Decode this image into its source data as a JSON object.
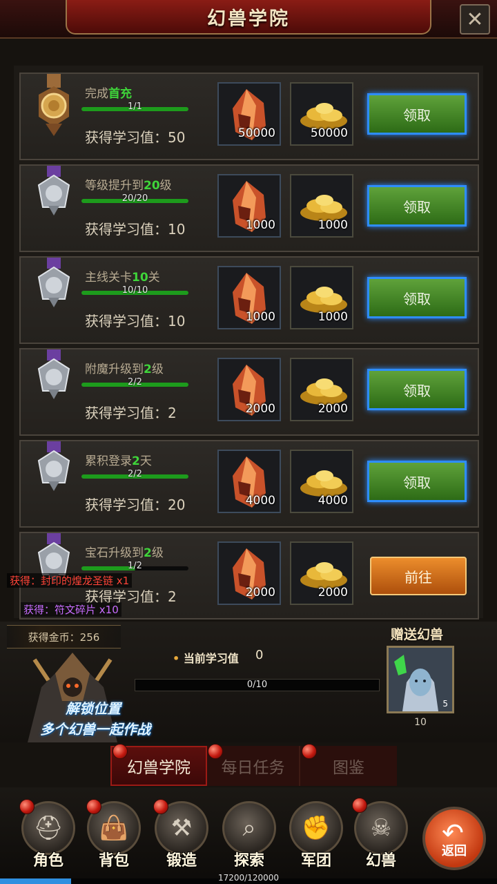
{
  "header": {
    "title": "幻兽学院",
    "close_icon": "close-x-icon"
  },
  "tasks": [
    {
      "name_prefix": "完成",
      "name_highlight": "首充",
      "name_suffix": "",
      "progress": "1/1",
      "progress_value": 1.0,
      "reward": "获得学习值：50",
      "item1_count": "50000",
      "item2_count": "50000",
      "action": "领取",
      "action_type": "claim",
      "medal": "gold-medal-icon"
    },
    {
      "name_prefix": "等级提升到",
      "name_highlight": "20",
      "name_suffix": "级",
      "progress": "20/20",
      "progress_value": 1.0,
      "reward": "获得学习值：10",
      "item1_count": "1000",
      "item2_count": "1000",
      "action": "领取",
      "action_type": "claim",
      "medal": "silver-medal-icon"
    },
    {
      "name_prefix": "主线关卡",
      "name_highlight": "10",
      "name_suffix": "关",
      "progress": "10/10",
      "progress_value": 1.0,
      "reward": "获得学习值：10",
      "item1_count": "1000",
      "item2_count": "1000",
      "action": "领取",
      "action_type": "claim",
      "medal": "silver-medal-icon"
    },
    {
      "name_prefix": "附魔升级到",
      "name_highlight": "2",
      "name_suffix": "级",
      "progress": "2/2",
      "progress_value": 1.0,
      "reward": "获得学习值：2",
      "item1_count": "2000",
      "item2_count": "2000",
      "action": "领取",
      "action_type": "claim",
      "medal": "silver-medal-icon"
    },
    {
      "name_prefix": "累积登录",
      "name_highlight": "2",
      "name_suffix": "天",
      "progress": "2/2",
      "progress_value": 1.0,
      "reward": "获得学习值：20",
      "item1_count": "4000",
      "item2_count": "4000",
      "action": "领取",
      "action_type": "claim",
      "medal": "silver-medal-icon"
    },
    {
      "name_prefix": "宝石升级到",
      "name_highlight": "2",
      "name_suffix": "级",
      "progress": "1/2",
      "progress_value": 0.5,
      "reward": "获得学习值：2",
      "item1_count": "2000",
      "item2_count": "2000",
      "action": "前往",
      "action_type": "goto",
      "medal": "silver-medal-icon"
    }
  ],
  "toasts": {
    "item1": "获得：封印的煌龙圣链 x1",
    "item2": "获得：符文碎片 x10",
    "gold": "获得金币：256"
  },
  "info": {
    "unlock_line1": "解锁位置",
    "unlock_line2": "多个幻兽一起作战",
    "current_label": "当前学习值",
    "current_value": "0",
    "xp_progress": "0/10",
    "gift_title": "赠送幻兽",
    "gift_level": "5",
    "gift_count": "10"
  },
  "tabs": [
    {
      "label": "幻兽学院",
      "active": true
    },
    {
      "label": "每日任务",
      "active": false
    },
    {
      "label": "图鉴",
      "active": false
    }
  ],
  "nav": [
    {
      "label": "角色",
      "icon": "helmet-icon"
    },
    {
      "label": "背包",
      "icon": "bag-icon"
    },
    {
      "label": "锻造",
      "icon": "hammer-icon"
    },
    {
      "label": "探索",
      "icon": "magnifier-icon"
    },
    {
      "label": "军团",
      "icon": "gauntlet-icon"
    },
    {
      "label": "幻兽",
      "icon": "beast-icon"
    }
  ],
  "back": {
    "label": "返回"
  },
  "exp": {
    "text": "17200/120000",
    "value": 0.143
  },
  "colors": {
    "highlight": "#3fd53a",
    "claim_border": "#2e8dff",
    "goto": "#ec8d2c",
    "item_toast": "#ff4438",
    "rune_toast": "#c86cff"
  }
}
